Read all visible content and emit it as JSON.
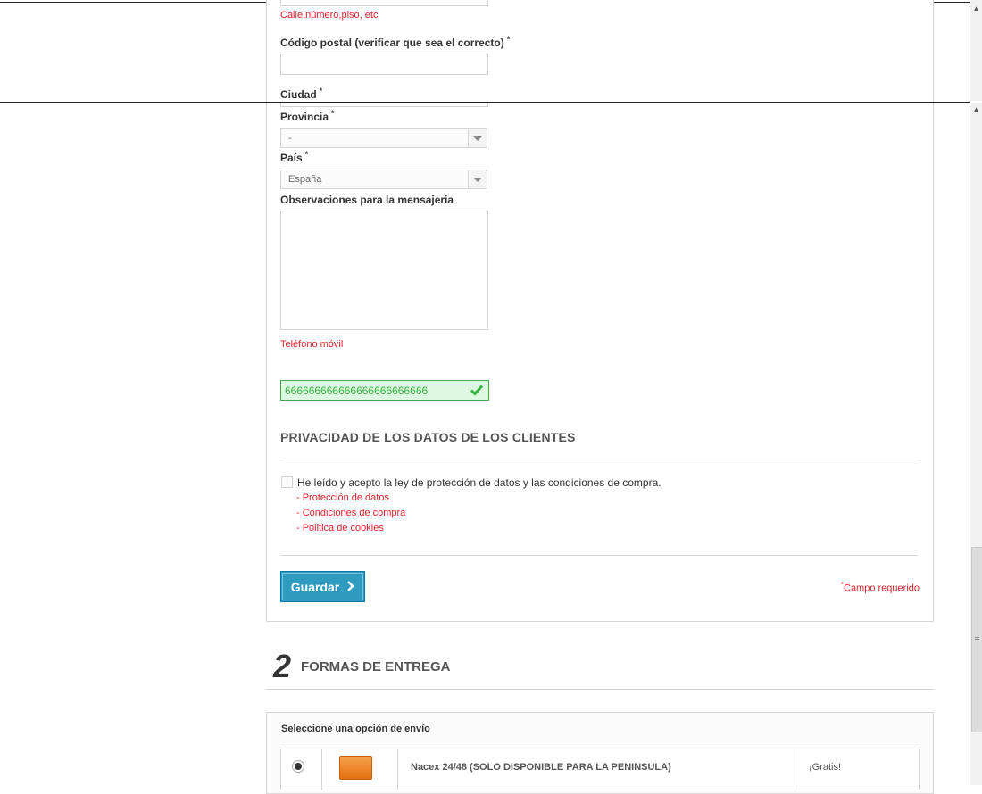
{
  "address_hint": "Calle,número,piso, etc",
  "fields": {
    "postal_code_label": "Código postal (verificar que sea el correcto)",
    "city_label": "Ciudad",
    "province_label": "Provincia",
    "province_value": "-",
    "country_label": "País",
    "country_value": "España",
    "observations_label": "Observaciones para la mensajeria",
    "mobile_label": "Teléfono móvil",
    "mobile_value": "666666666666666666666666",
    "required_mark": "*"
  },
  "privacy": {
    "title": "PRIVACIDAD DE LOS DATOS DE LOS CLIENTES",
    "checkbox_text": "He leído y acepto la ley de protección de datos y las condiciones de compra.",
    "links": [
      "- Protección de datos",
      "- Condiciones de compra",
      "- Politica de cookies"
    ]
  },
  "actions": {
    "save_label": "Guardar",
    "required_note": "Campo requerido"
  },
  "delivery": {
    "step_number": "2",
    "title": "FORMAS DE ENTREGA",
    "select_label": "Seleccione una opción de envío",
    "options": [
      {
        "name": "Nacex 24/48 (SOLO DISPONIBLE PARA LA PENINSULA)",
        "price": "¡Gratis!",
        "selected": true
      }
    ]
  },
  "colors": {
    "required_red": "#e5232c",
    "save_button": "#2e9bbf",
    "valid_green": "#35b33f"
  }
}
